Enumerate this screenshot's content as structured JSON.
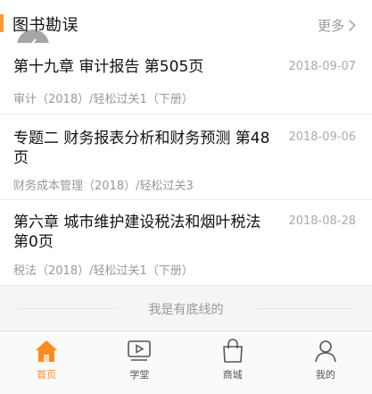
{
  "header": {
    "title": "图书勘误",
    "more_label": "更多"
  },
  "errata": [
    {
      "title": "第十九章 审计报告 第505页",
      "date": "2018-09-07",
      "source": "审计（2018）/轻松过关1（下册）"
    },
    {
      "title": "专题二 财务报表分析和财务预测 第48页",
      "date": "2018-09-06",
      "source": "财务成本管理（2018）/轻松过关3"
    },
    {
      "title": "第六章 城市维护建设税法和烟叶税法 第0页",
      "date": "2018-08-28",
      "source": "税法（2018）/轻松过关1（下册）"
    }
  ],
  "footer_note": "我是有底线的",
  "tabbar": {
    "items": [
      {
        "label": "首页",
        "icon": "home-icon",
        "active": true
      },
      {
        "label": "学堂",
        "icon": "video-icon",
        "active": false
      },
      {
        "label": "商城",
        "icon": "shopping-bag-icon",
        "active": false
      },
      {
        "label": "我的",
        "icon": "user-icon",
        "active": false
      }
    ]
  },
  "colors": {
    "accent": "#ff8a1f",
    "header_bar": "#ff9a2e",
    "muted_text": "#999999",
    "divider": "#ececec"
  }
}
